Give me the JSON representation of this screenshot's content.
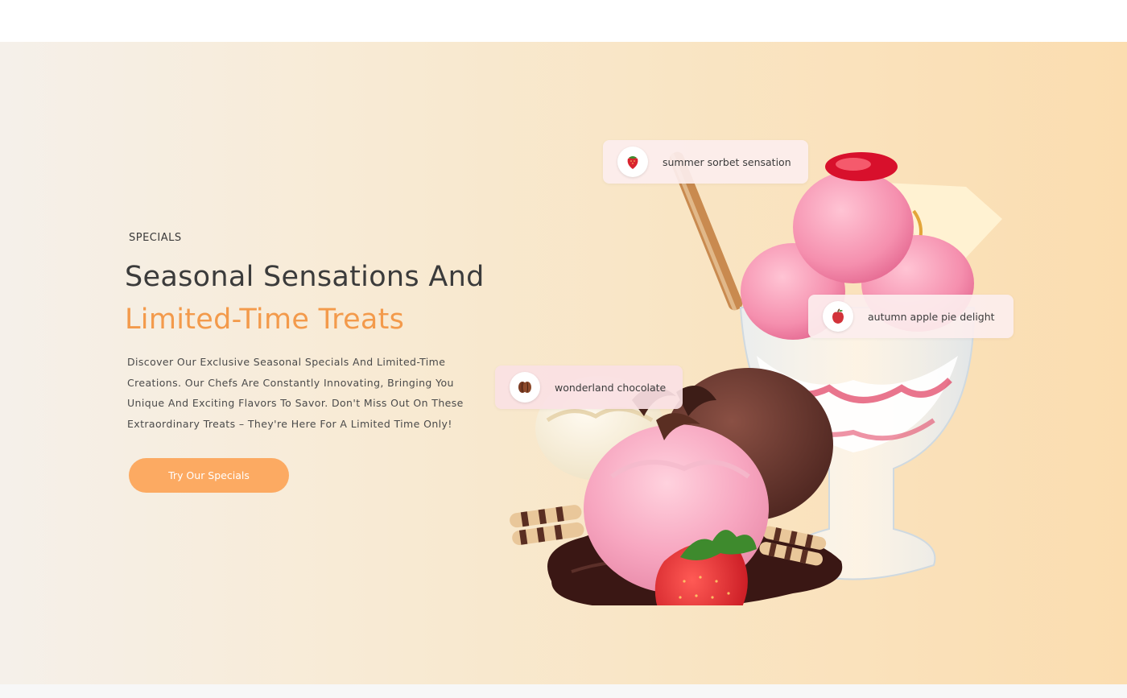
{
  "hero": {
    "eyebrow": "SPECIALS",
    "headline_line1": "Seasonal Sensations And",
    "headline_line2": "Limited-Time Treats",
    "description": "Discover Our Exclusive Seasonal Specials And Limited-Time Creations. Our Chefs Are Constantly Innovating, Bringing You Unique And Exciting Flavors To Savor. Don't Miss Out On These Extraordinary Treats – They're Here For A Limited Time Only!",
    "cta_label": "Try Our Specials"
  },
  "tags": [
    {
      "label": "summer sorbet sensation",
      "icon": "strawberry-icon"
    },
    {
      "label": "autumn apple pie delight",
      "icon": "apple-icon"
    },
    {
      "label": "wonderland chocolate",
      "icon": "cocoa-bean-icon"
    }
  ],
  "colors": {
    "accent": "#f39a4b",
    "button": "#fcaa62",
    "heading": "#3b3b3b"
  }
}
